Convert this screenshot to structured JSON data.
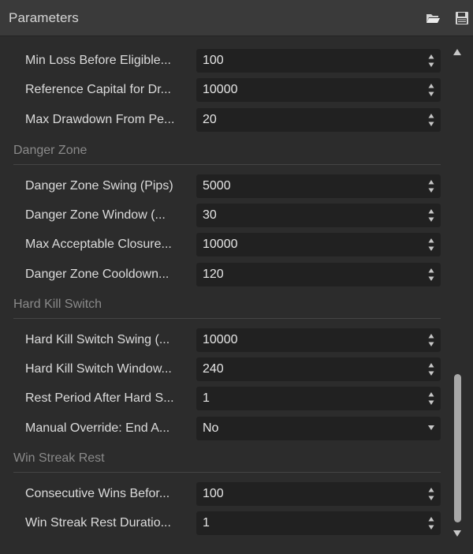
{
  "header": {
    "title": "Parameters",
    "icons": [
      "folder-open-icon",
      "save-icon"
    ]
  },
  "rows_top": [
    {
      "label": "Min Loss Before Eligible...",
      "value": "100",
      "control": "stepper"
    },
    {
      "label": "Reference Capital for Dr...",
      "value": "10000",
      "control": "stepper"
    },
    {
      "label": "Max Drawdown From Pe...",
      "value": "20",
      "control": "stepper"
    }
  ],
  "sections": [
    {
      "title": "Danger Zone",
      "rows": [
        {
          "label": "Danger Zone Swing (Pips)",
          "value": "5000",
          "control": "stepper"
        },
        {
          "label": "Danger Zone Window (...",
          "value": "30",
          "control": "stepper"
        },
        {
          "label": "Max Acceptable Closure...",
          "value": "10000",
          "control": "stepper"
        },
        {
          "label": "Danger Zone Cooldown...",
          "value": "120",
          "control": "stepper"
        }
      ]
    },
    {
      "title": "Hard Kill Switch",
      "rows": [
        {
          "label": "Hard Kill Switch Swing (...",
          "value": "10000",
          "control": "stepper"
        },
        {
          "label": "Hard Kill Switch Window...",
          "value": "240",
          "control": "stepper"
        },
        {
          "label": "Rest Period After Hard S...",
          "value": "1",
          "control": "stepper"
        },
        {
          "label": "Manual Override: End A...",
          "value": "No",
          "control": "dropdown"
        }
      ]
    },
    {
      "title": "Win Streak Rest",
      "rows": [
        {
          "label": "Consecutive Wins Befor...",
          "value": "100",
          "control": "stepper"
        },
        {
          "label": "Win Streak Rest Duratio...",
          "value": "1",
          "control": "stepper"
        }
      ]
    }
  ],
  "colors": {
    "background": "#2c2c2c",
    "header": "#3a3a3a",
    "field": "#212121",
    "label": "#dcdcdc",
    "section_title": "#8a8a8a",
    "scrollbar_thumb": "#a8a8a8"
  }
}
